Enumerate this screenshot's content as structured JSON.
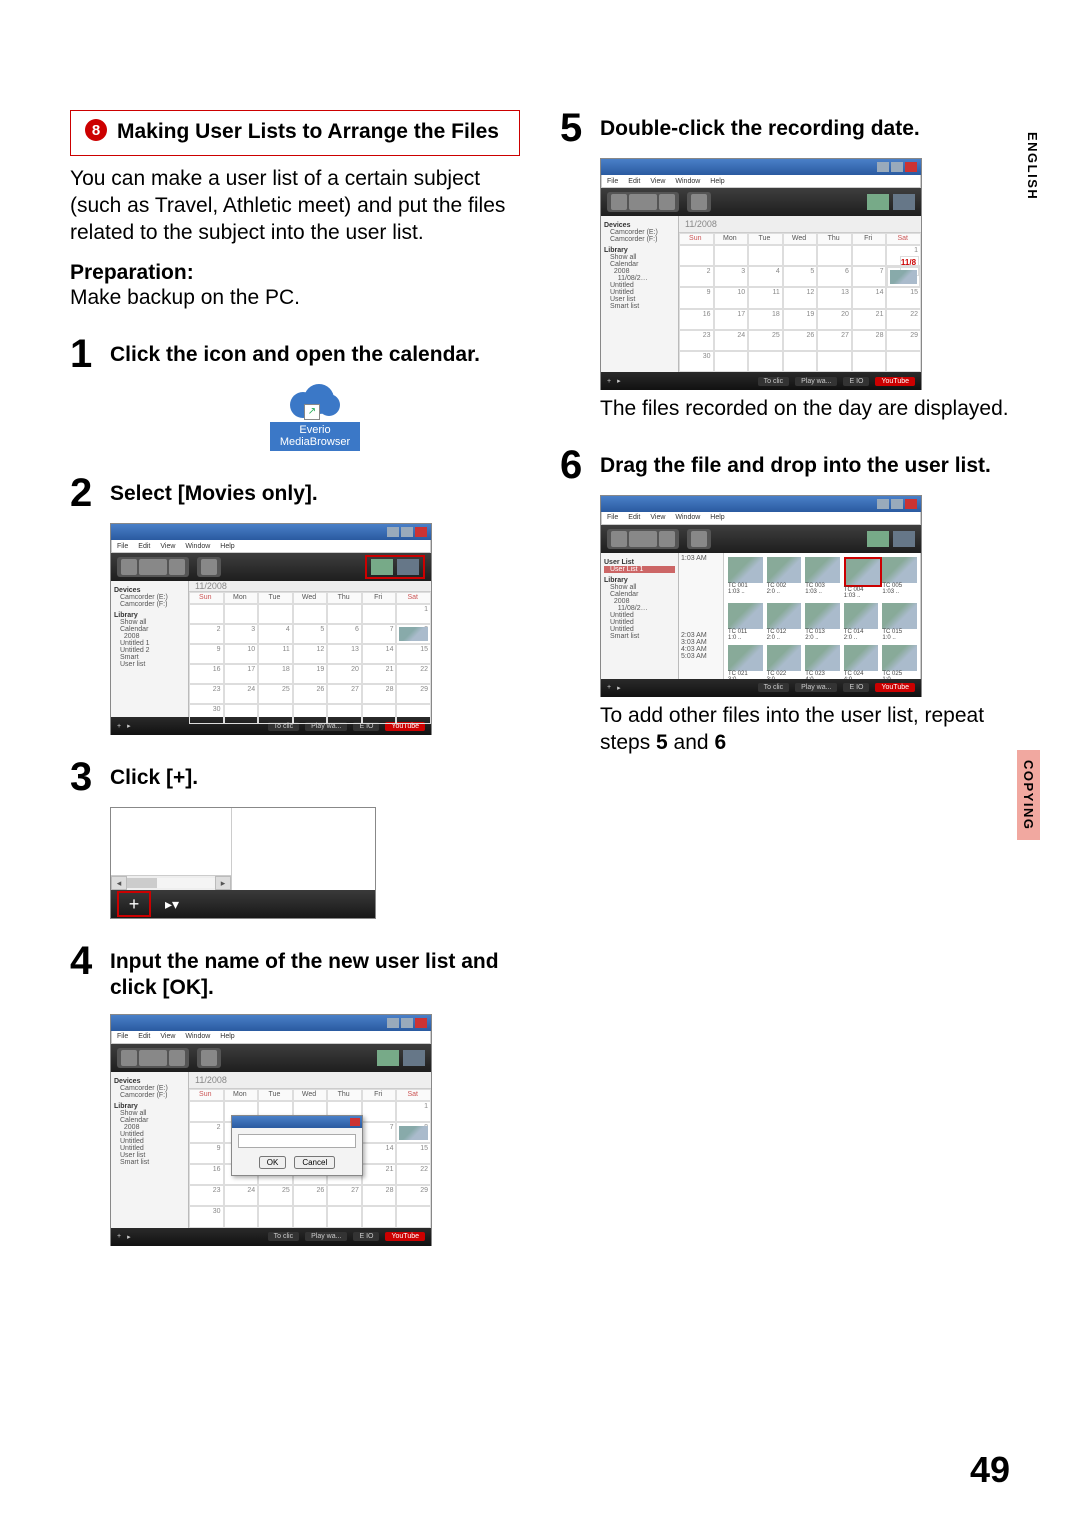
{
  "sidetabs": {
    "english": "ENGLISH",
    "copying": "COPYING"
  },
  "page_number": "49",
  "callout": {
    "badge": "8",
    "title": "Making User Lists to Arrange the Files"
  },
  "intro": "You can make a user list of a certain subject (such as Travel, Athletic meet) and put the files related to the subject into the user list.",
  "prep_label": "Preparation:",
  "prep_body": "Make backup on the PC.",
  "dayhdr": [
    "Sun",
    "Mon",
    "Tue",
    "Wed",
    "Thu",
    "Fri",
    "Sat"
  ],
  "month": "11/2008",
  "steps": {
    "s1": {
      "num": "1",
      "title": "Click the icon and open the calendar."
    },
    "s2": {
      "num": "2",
      "title": "Select [Movies only]."
    },
    "s3": {
      "num": "3",
      "title": "Click [+]."
    },
    "s4": {
      "num": "4",
      "title": "Input the name of the new user list and click [OK]."
    },
    "s5": {
      "num": "5",
      "title": "Double-click the recording date."
    },
    "s5_body": "The files recorded on the day are displayed.",
    "s6": {
      "num": "6",
      "title": "Drag the file and drop into the user list."
    },
    "s6_body_a": "To add other files into the user list, repeat steps ",
    "s6_body_b": "5",
    "s6_body_c": " and ",
    "s6_body_d": "6"
  },
  "icon": {
    "line1": "Everio",
    "line2": "MediaBrowser"
  },
  "status_buttons": [
    "To clic",
    "Play wa...",
    "E IO"
  ],
  "youtube": "YouTube",
  "dialog": {
    "ok": "OK",
    "cancel": "Cancel"
  },
  "time_col": [
    "1:03 AM",
    "",
    "",
    "2:03 AM",
    "3:03 AM",
    "4:03 AM",
    "5:03 AM"
  ],
  "highlight_date": "11/8"
}
